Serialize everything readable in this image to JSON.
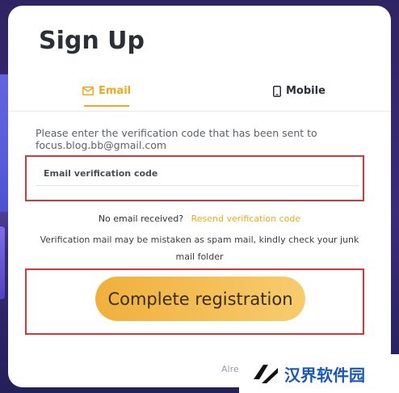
{
  "title": "Sign Up",
  "tabs": {
    "email": "Email",
    "mobile": "Mobile"
  },
  "instruction": "Please enter the verification code that has been sent to focus.blog.bb@gmail.com",
  "code_field": {
    "placeholder": "Email verification code",
    "value": ""
  },
  "no_email": {
    "question": "No email received?",
    "resend": "Resend verification code"
  },
  "spam_note": "Verification mail may be mistaken as spam mail, kindly check your junk mail folder",
  "complete_button": "Complete registration",
  "already": "Alre",
  "watermark": "汉界软件园",
  "colors": {
    "accent": "#f0a81f",
    "highlight": "#d13a3a",
    "backdrop": "#3b2b79"
  }
}
